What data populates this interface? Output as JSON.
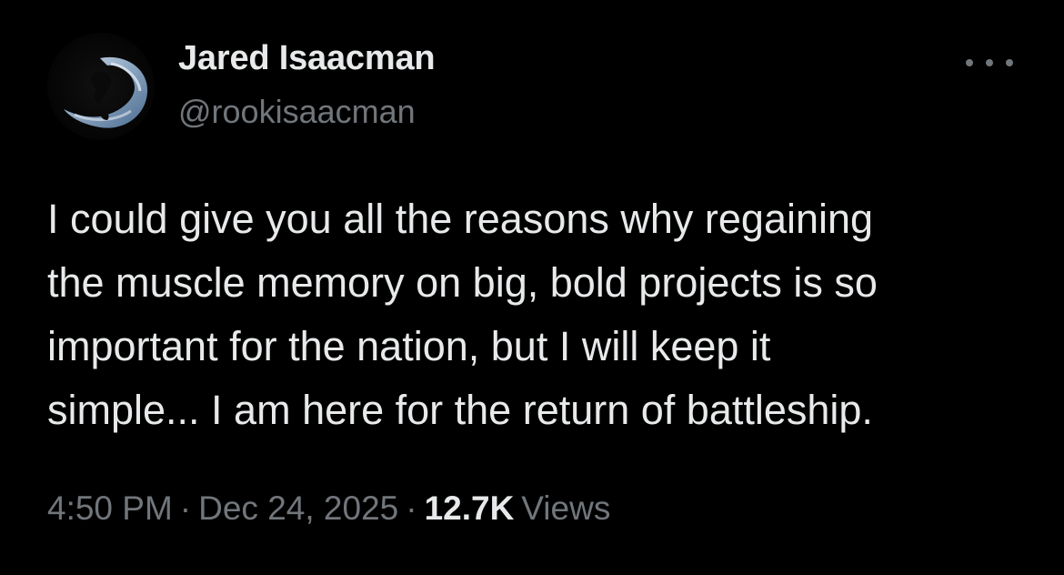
{
  "author": {
    "display_name": "Jared Isaacman",
    "handle": "@rookisaacman",
    "avatar_icon": "earth-horizon-avatar"
  },
  "more_menu": {
    "icon": "more-horizontal-icon"
  },
  "tweet": {
    "lines": [
      "I could give you all the reasons why regaining",
      "the muscle memory on big, bold projects is so",
      "important for the nation, but I will keep it",
      "simple... I am here for the return of battleship."
    ]
  },
  "meta": {
    "time": "4:50 PM",
    "separator": "·",
    "date": "Dec 24, 2025",
    "views_count": "12.7K",
    "views_label": "Views"
  },
  "colors": {
    "background": "#000000",
    "primary_text": "#e7e9ea",
    "secondary_text": "#71767b"
  }
}
